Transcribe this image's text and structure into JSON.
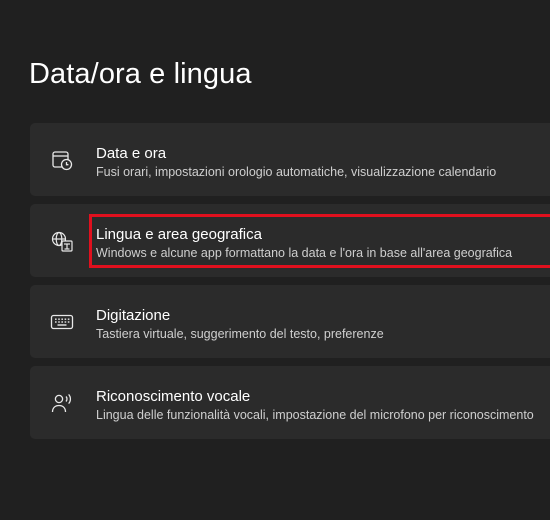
{
  "page": {
    "title": "Data/ora e lingua"
  },
  "cards": [
    {
      "icon": "calendar-clock-icon",
      "title": "Data e ora",
      "subtitle": "Fusi orari, impostazioni orologio automatiche, visualizzazione calendario"
    },
    {
      "icon": "language-region-icon",
      "title": "Lingua e area geografica",
      "subtitle": "Windows e alcune app formattano la data e l'ora in base all'area geografica"
    },
    {
      "icon": "keyboard-icon",
      "title": "Digitazione",
      "subtitle": "Tastiera virtuale, suggerimento del testo, preferenze"
    },
    {
      "icon": "speech-icon",
      "title": "Riconoscimento vocale",
      "subtitle": "Lingua delle funzionalità vocali, impostazione del microfono per riconoscimento"
    }
  ],
  "highlight": {
    "color": "#e0101e"
  }
}
